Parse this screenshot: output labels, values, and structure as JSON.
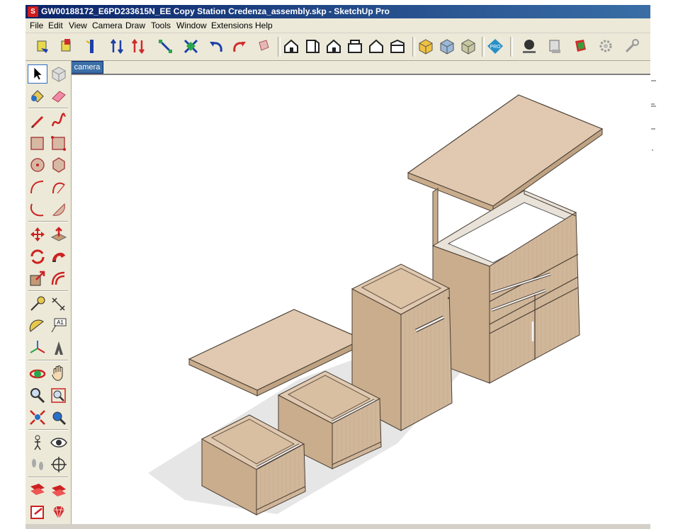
{
  "window": {
    "title": "GW00188172_E6PD233615N_EE Copy Station Credenza_assembly.skp - SketchUp Pro"
  },
  "menu": {
    "items": [
      "File",
      "Edit",
      "View",
      "Camera",
      "Draw",
      "Tools",
      "Window",
      "Extensions",
      "Help"
    ]
  },
  "scene_tabs": [
    "camera"
  ],
  "toolbar_top": {
    "icons": [
      "get-models-icon",
      "share-model-icon",
      "get-models-3d-icon",
      "push-pull-up-icon",
      "push-pull-down-icon",
      "dimension-diagonal-icon",
      "section-plane-icon",
      "undo-icon",
      "redo-icon",
      "paint-roll-icon",
      "iso-view-icon",
      "front-view-icon",
      "top-view-icon",
      "right-view-icon",
      "back-view-icon",
      "left-view-icon",
      "xray-icon",
      "wireframe-icon",
      "shaded-icon",
      "layout-pro-icon",
      "shadow-globe-icon",
      "print-icon",
      "styles-icon",
      "settings-gear-icon",
      "wrench-icon"
    ]
  },
  "left_toolbar": {
    "icons": [
      "select-arrow-icon",
      "make-component-icon",
      "paint-bucket-icon",
      "eraser-icon",
      "pencil-line-icon",
      "freehand-icon",
      "rectangle-icon",
      "rotated-rectangle-icon",
      "circle-icon",
      "polygon-icon",
      "arc-icon",
      "two-point-arc-icon",
      "three-point-arc-icon",
      "pie-icon",
      "move-icon",
      "push-pull-icon",
      "rotate-icon",
      "follow-me-icon",
      "scale-icon",
      "offset-icon",
      "tape-measure-icon",
      "dimension-icon",
      "protractor-icon",
      "text-icon",
      "axes-icon",
      "3d-text-icon",
      "orbit-icon",
      "pan-icon",
      "zoom-icon",
      "zoom-window-icon",
      "zoom-extents-icon",
      "previous-view-icon",
      "position-camera-icon",
      "look-around-icon",
      "walk-icon",
      "section-plane-tool-icon",
      "sandbox-from-contours-icon",
      "sandbox-from-scratch-icon",
      "extension-warehouse-icon",
      "ruby-gem-icon"
    ]
  },
  "colors": {
    "wood_top": "#e0c9b0",
    "wood_front": "#d1b79a",
    "wood_side": "#c3a887",
    "edge": "#4a3f35",
    "shadow": "#dcdcdc"
  }
}
